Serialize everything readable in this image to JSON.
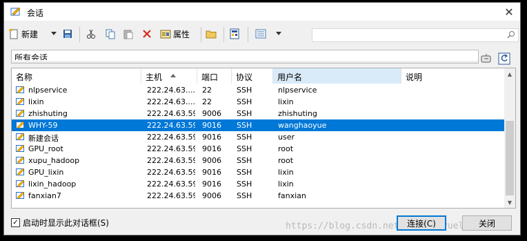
{
  "window": {
    "title": "会话"
  },
  "toolbar": {
    "new_label": "新建",
    "properties_label": "属性",
    "search_placeholder": ""
  },
  "pathbar": {
    "label": "所有会话"
  },
  "columns": [
    {
      "label": "名称"
    },
    {
      "label": "主机",
      "sort": "ascending"
    },
    {
      "label": "端口"
    },
    {
      "label": "协议"
    },
    {
      "label": "用户名"
    },
    {
      "label": "说明"
    }
  ],
  "sessions": [
    {
      "name": "nlpservice",
      "host": "222.24.63....",
      "port": "22",
      "protocol": "SSH",
      "user": "nlpservice",
      "desc": ""
    },
    {
      "name": "lixin",
      "host": "222.24.63....",
      "port": "22",
      "protocol": "SSH",
      "user": "lixin",
      "desc": ""
    },
    {
      "name": "zhishuting",
      "host": "222.24.63.59",
      "port": "9006",
      "protocol": "SSH",
      "user": "zhishuting",
      "desc": ""
    },
    {
      "name": "WHY-59",
      "host": "222.24.63.59",
      "port": "9016",
      "protocol": "SSH",
      "user": "wanghaoyue",
      "desc": "",
      "selected": true
    },
    {
      "name": "新建会话",
      "host": "222.24.63.59",
      "port": "9016",
      "protocol": "SSH",
      "user": "user",
      "desc": ""
    },
    {
      "name": "GPU_root",
      "host": "222.24.63.59",
      "port": "9016",
      "protocol": "SSH",
      "user": "root",
      "desc": ""
    },
    {
      "name": "xupu_hadoop",
      "host": "222.24.63.59",
      "port": "9006",
      "protocol": "SSH",
      "user": "root",
      "desc": ""
    },
    {
      "name": "GPU_lixin",
      "host": "222.24.63.59",
      "port": "9016",
      "protocol": "SSH",
      "user": "lixin",
      "desc": ""
    },
    {
      "name": "lixin_hadoop",
      "host": "222.24.63.59",
      "port": "9016",
      "protocol": "SSH",
      "user": "lixin",
      "desc": ""
    },
    {
      "name": "fanxian7",
      "host": "222.24.63.59",
      "port": "9006",
      "protocol": "SSH",
      "user": "fanxian",
      "desc": ""
    }
  ],
  "footer": {
    "show_on_startup_label": "启动时显示此对话框(S)",
    "show_on_startup_checked": true,
    "connect_label": "连接(C)",
    "close_label": "关闭"
  },
  "watermark": "https://blog.csdn.net/wanghaoyuelang",
  "colors": {
    "selection": "#0078d7",
    "header_active": "#d9ebf9"
  }
}
